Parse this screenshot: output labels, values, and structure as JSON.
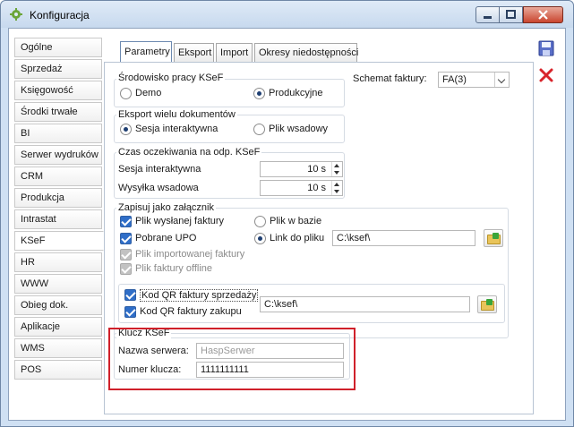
{
  "window": {
    "title": "Konfiguracja"
  },
  "sidebar": {
    "items": [
      {
        "label": "Ogólne"
      },
      {
        "label": "Sprzedaż"
      },
      {
        "label": "Księgowość"
      },
      {
        "label": "Środki trwałe"
      },
      {
        "label": "BI"
      },
      {
        "label": "Serwer wydruków"
      },
      {
        "label": "CRM"
      },
      {
        "label": "Produkcja"
      },
      {
        "label": "Intrastat"
      },
      {
        "label": "KSeF",
        "active": true
      },
      {
        "label": "HR"
      },
      {
        "label": "WWW"
      },
      {
        "label": "Obieg dok."
      },
      {
        "label": "Aplikacje"
      },
      {
        "label": "WMS"
      },
      {
        "label": "POS"
      }
    ]
  },
  "tabs": [
    {
      "label": "Parametry",
      "active": true
    },
    {
      "label": "Eksport"
    },
    {
      "label": "Import"
    },
    {
      "label": "Okresy niedostępności"
    }
  ],
  "environment": {
    "title": "Środowisko pracy KSeF",
    "options": [
      {
        "label": "Demo",
        "selected": false
      },
      {
        "label": "Produkcyjne",
        "selected": true
      }
    ]
  },
  "schema": {
    "label": "Schemat faktury:",
    "value": "FA(3)"
  },
  "export_multi": {
    "title": "Eksport wielu dokumentów",
    "options": [
      {
        "label": "Sesja interaktywna",
        "selected": true
      },
      {
        "label": "Plik wsadowy",
        "selected": false
      }
    ]
  },
  "wait_time": {
    "title": "Czas oczekiwania na odp. KSeF",
    "rows": [
      {
        "label": "Sesja interaktywna",
        "value": "10 s"
      },
      {
        "label": "Wysyłka wsadowa",
        "value": "10 s"
      }
    ]
  },
  "attachment": {
    "title": "Zapisuj jako załącznik",
    "checks": [
      {
        "label": "Plik wysłanej faktury",
        "checked": true,
        "disabled": false
      },
      {
        "label": "Pobrane UPO",
        "checked": true,
        "disabled": false
      },
      {
        "label": "Plik importowanej faktury",
        "checked": true,
        "disabled": true
      },
      {
        "label": "Plik faktury offline",
        "checked": true,
        "disabled": true
      }
    ],
    "radios": [
      {
        "label": "Plik w bazie",
        "selected": false
      },
      {
        "label": "Link do pliku",
        "selected": true
      }
    ],
    "path": "C:\\ksef\\"
  },
  "qr": {
    "checks": [
      {
        "label": "Kod QR faktury sprzedaży",
        "checked": true
      },
      {
        "label": "Kod QR faktury zakupu",
        "checked": true
      }
    ],
    "path": "C:\\ksef\\"
  },
  "key": {
    "title": "Klucz KSeF",
    "server_label": "Nazwa serwera:",
    "server_value": "HaspSerwer",
    "number_label": "Numer klucza:",
    "number_value": "1111111111"
  },
  "colors": {
    "highlight_frame": "#d0202a",
    "accent": "#2f6ec8"
  },
  "icons": [
    "app-gear-icon",
    "save-icon",
    "cancel-icon",
    "folder-icon"
  ]
}
